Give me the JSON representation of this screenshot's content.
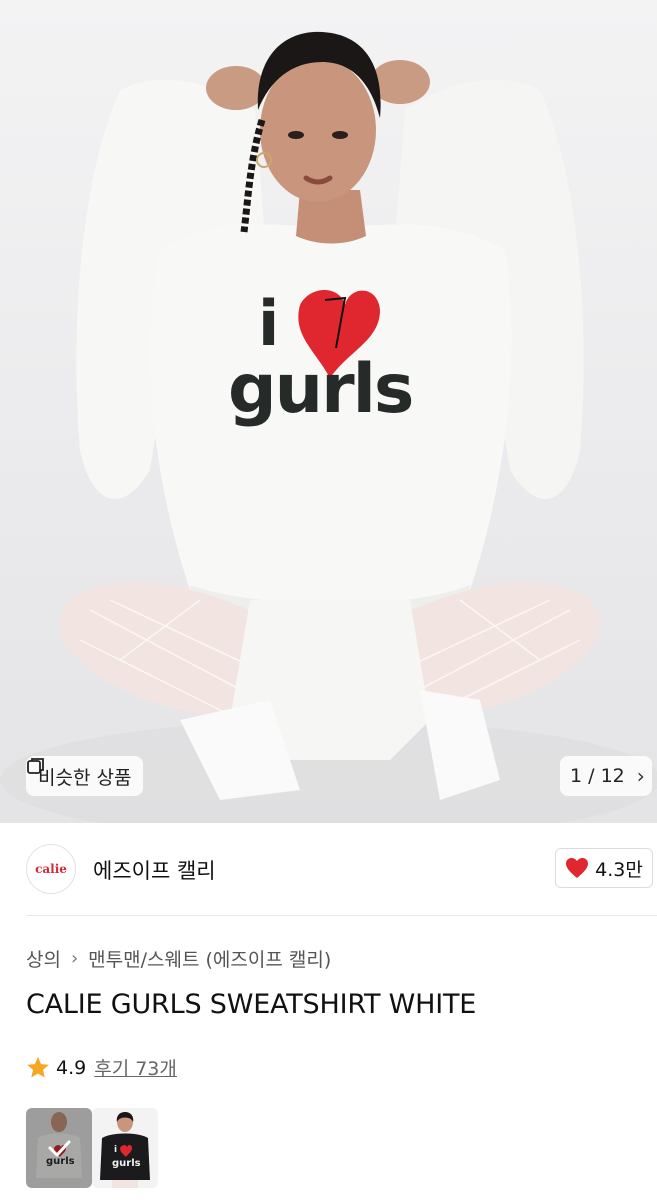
{
  "hero": {
    "image_alt": "Model wearing white sweatshirt with red heart print",
    "print_line1": "i",
    "print_line2": "gurls",
    "similar_label": "비슷한 상품",
    "counter": "1 / 12"
  },
  "brand": {
    "logo_text": "calie",
    "name": "에즈이프 캘리",
    "like_count": "4.3만"
  },
  "breadcrumb": {
    "category": "상의",
    "subcategory": "맨투맨/스웨트 (에즈이프 캘리)"
  },
  "product": {
    "title": "CALIE GURLS SWEATSHIRT WHITE",
    "rating": "4.9",
    "reviews": "후기 73개"
  },
  "thumbnails": [
    {
      "print_line1": "i",
      "print_line2": "gurls",
      "selected": true
    },
    {
      "print_line1": "i",
      "print_line2": "gurls",
      "selected": false
    }
  ],
  "colors": {
    "heart": "#e0262f",
    "star": "#f5a623",
    "sweatshirt_white": "#f8f8f6",
    "sweatshirt_black": "#1b1b1d"
  }
}
